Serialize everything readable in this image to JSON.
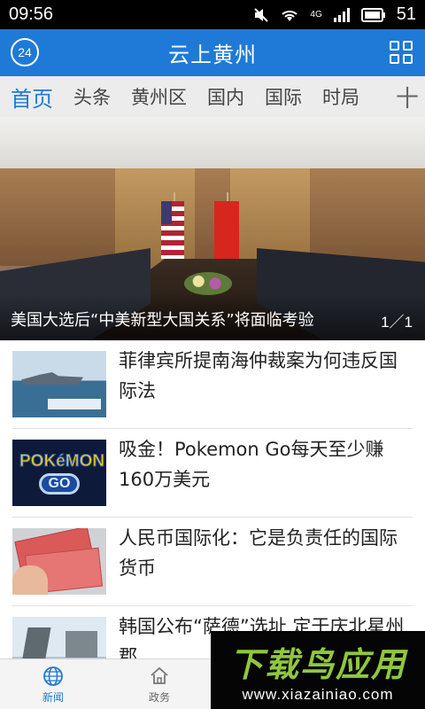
{
  "status_bar": {
    "time": "09:56",
    "network": "4G",
    "battery": "51"
  },
  "header": {
    "title": "云上黄州",
    "logo": "24"
  },
  "tabs": [
    "首页",
    "头条",
    "黄州区",
    "国内",
    "国际",
    "时局"
  ],
  "tab_add": "十",
  "hero": {
    "caption": "美国大选后“中美新型大国关系”将面临考验",
    "counter": "1／1"
  },
  "news": [
    {
      "title": "菲律宾所提南海仲裁案为何违反国际法",
      "thumb": "warship-image"
    },
    {
      "title": "吸金！Pokemon Go每天至少赚160万美元",
      "thumb": "pokemon-go-logo"
    },
    {
      "title": "人民币国际化：它是负责任的国际货币",
      "thumb": "rmb-banknotes-image"
    },
    {
      "title": "韩国公布“萨德”选址 定于庆北星州郡",
      "thumb": "missile-launcher-image"
    }
  ],
  "thumb_text": {
    "pokemon": "POKéMON",
    "go": "GO"
  },
  "bottom_nav": [
    {
      "label": "新闻",
      "icon": "globe-icon",
      "active": true
    },
    {
      "label": "政务",
      "icon": "government-building-icon",
      "active": false
    }
  ],
  "watermark": {
    "brand": "下载鸟应用",
    "url": "www.xiazainiao.com"
  },
  "colors": {
    "accent": "#1e7ad6",
    "tab_bar": "#ececec",
    "watermark_green": "#8fc73e"
  }
}
